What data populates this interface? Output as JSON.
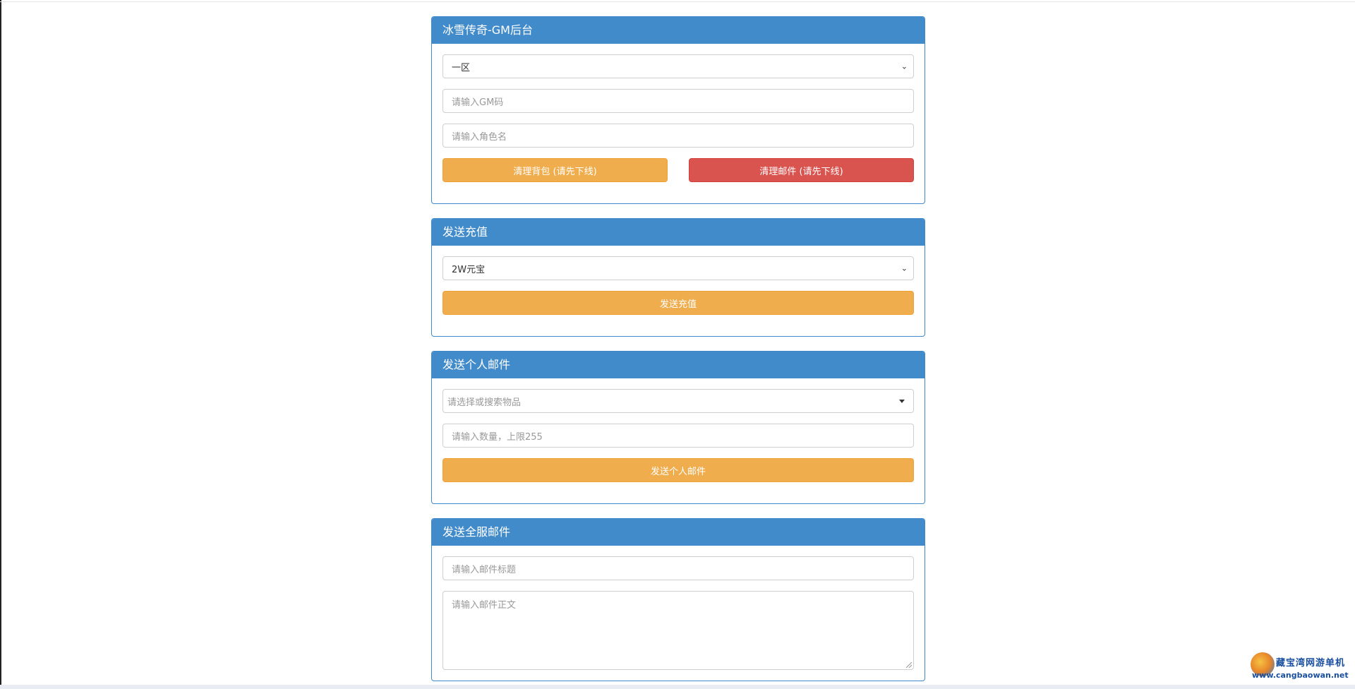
{
  "gm_panel": {
    "title": "冰雪传奇-GM后台",
    "server_select": "一区",
    "gm_code_placeholder": "请输入GM码",
    "role_name_placeholder": "请输入角色名",
    "clear_bag_label": "清理背包 (请先下线)",
    "clear_mail_label": "清理邮件 (请先下线)"
  },
  "recharge_panel": {
    "title": "发送充值",
    "amount_select": "2W元宝",
    "send_label": "发送充值"
  },
  "personal_mail_panel": {
    "title": "发送个人邮件",
    "item_search_placeholder": "请选择或搜索物品",
    "quantity_placeholder": "请输入数量，上限255",
    "send_label": "发送个人邮件"
  },
  "server_mail_panel": {
    "title": "发送全服邮件",
    "subject_placeholder": "请输入邮件标题",
    "body_placeholder": "请输入邮件正文"
  },
  "watermark": {
    "name": "藏宝湾网游单机",
    "url": "www.cangbaowan.net"
  },
  "colors": {
    "panel_header": "#428bca",
    "warning": "#f0ad4e",
    "danger": "#d9534f"
  }
}
